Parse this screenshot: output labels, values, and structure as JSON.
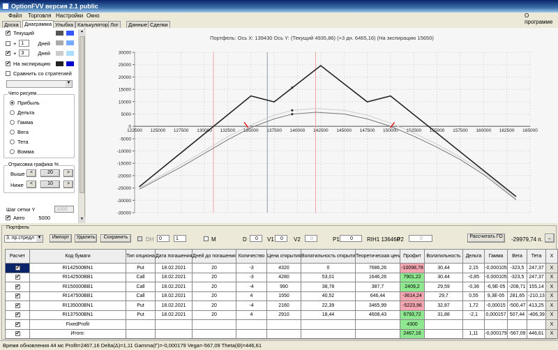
{
  "window": {
    "title": "OptionFVV версия 2.1 public"
  },
  "menu": [
    "Файл",
    "Торговля",
    "Настройки",
    "Окно"
  ],
  "menu_right": "О программе",
  "tabs": [
    "Доска",
    "Диаграмма",
    "Улыбка",
    "Калькулятор",
    "Лог",
    "Данные",
    "Сделки"
  ],
  "active_tab": "Диаграмма",
  "left": {
    "current": {
      "label": "Текущий",
      "checked": true,
      "colors": [
        "#555555",
        "#3355ff"
      ]
    },
    "plus1": {
      "plus": "+",
      "days": "1",
      "unit": "Дней",
      "checked": false,
      "colors": [
        "#aaaaaa",
        "#77aaff"
      ]
    },
    "plus2": {
      "plus": "+",
      "days": "3",
      "unit": "Дней",
      "checked": true,
      "colors": [
        "#cccccc",
        "#aaddff"
      ]
    },
    "expiry": {
      "label": "На экспирацию",
      "checked": true,
      "colors": [
        "#222222",
        "#0000cc"
      ]
    },
    "compare": {
      "label": "Сравнить со стратегией",
      "checked": false
    },
    "draw_group": {
      "title": "Чего рисуем",
      "options": [
        "Прибыль",
        "Дельта",
        "Гамма",
        "Вега",
        "Тета",
        "Вомма"
      ],
      "selected": "Прибыль"
    },
    "range_group": {
      "title": "Отрисовка графика %",
      "above_label": "Выше",
      "above": "20",
      "below_label": "Ниже",
      "below": "10",
      "dec": "<",
      "inc": ">"
    },
    "grid_step_label": "Шаг сетки Y",
    "grid_step": "1000",
    "auto_label": "Авто",
    "auto_checked": true,
    "auto_value": "5000"
  },
  "chart_header": "Портфель: Ось X: 139430 Ось Y:  (Текущий 4935,86)  (+3 дн. 6465,16)  (На экспирацию 15650)",
  "chart_data": {
    "type": "line",
    "xlim": [
      122500,
      165000
    ],
    "ylim": [
      -35000,
      30000
    ],
    "grid": true,
    "xticks": [
      122500,
      125000,
      127500,
      130000,
      132500,
      135000,
      137500,
      140000,
      142500,
      145000,
      147500,
      150000,
      152500,
      155000,
      157500,
      160000,
      162500,
      165000
    ],
    "yticks": [
      30000,
      25000,
      20000,
      15000,
      10000,
      5000,
      0,
      -5000,
      -10000,
      -15000,
      -20000,
      -25000,
      -30000,
      -35000
    ],
    "series": [
      {
        "color": "#222222",
        "x": [
          123000,
          135000,
          137500,
          142500,
          147500,
          150000,
          163500
        ],
        "y": [
          -24500,
          12300,
          9900,
          24600,
          9900,
          12300,
          -28500
        ]
      },
      {
        "color": "#cccccc",
        "x": [
          123000,
          127500,
          130000,
          132500,
          135000,
          137500,
          139430,
          142000,
          145000,
          147500,
          150000,
          152500,
          155000,
          157500,
          160000,
          163500
        ],
        "y": [
          -25000,
          -15500,
          -10000,
          -4200,
          500,
          4500,
          6465,
          7200,
          6500,
          4500,
          1300,
          -2700,
          -7300,
          -12500,
          -18500,
          -29500
        ]
      },
      {
        "color": "#777777",
        "x": [
          123000,
          127500,
          130000,
          132500,
          135000,
          137500,
          139430,
          142000,
          145000,
          147500,
          150000,
          152500,
          155000,
          157500,
          160000,
          163500
        ],
        "y": [
          -25500,
          -16500,
          -11000,
          -5500,
          -500,
          3000,
          4936,
          5700,
          5000,
          3000,
          0,
          -4000,
          -8500,
          -13500,
          -19500,
          -29800
        ]
      }
    ],
    "markers": [
      {
        "x": 139430,
        "y": 15650
      },
      {
        "x": 139430,
        "y": 4936
      },
      {
        "x": 139430,
        "y": 6465
      }
    ],
    "vlines": [
      {
        "x": 130970,
        "color": "#f4a0a0"
      },
      {
        "x": 136760,
        "color": "#8899aa"
      },
      {
        "x": 141950,
        "color": "#f4a0a0"
      }
    ],
    "red_ticks": [
      {
        "x": 134500,
        "y": 500
      },
      {
        "x": 150200,
        "y": 500
      }
    ]
  },
  "portfolio": {
    "title": "Портфель",
    "strategy": "3. пр.стредл",
    "import": "Импорт",
    "delete": "Удалить",
    "save": "Сохранить",
    "dh_label": "DH",
    "dh1": "0",
    "dh2": "1",
    "m_label": "M",
    "d_label": "D",
    "d": "0",
    "v1_label": "V1",
    "v1": "0",
    "v2_label": "V2",
    "v2": "0",
    "p1_label": "P1",
    "p1": "0",
    "ri": "RIH1 136460",
    "p2_label": "P2",
    "p2": "0",
    "calc_go": "Рассчитать ГО",
    "go_value": "-29979,74 п.",
    "minimize": "_",
    "columns": [
      "Расчет",
      "Код бумаги",
      "Тип опциона",
      "Дата погашения",
      "Дней до погашения",
      "Количество",
      "Цена открытия",
      "Волатильность открытия",
      "Теоретическая цена",
      "Профит",
      "Волатильность",
      "Дельта",
      "Гамма",
      "Вега",
      "Тета",
      "X"
    ],
    "rows": [
      [
        "RI142500BN1",
        "Put",
        "18.02.2021",
        "20",
        "-3",
        "4320",
        "0",
        "7686,26",
        "-10098,78",
        "30,44",
        "2,15",
        "-0,000105",
        "-323,5",
        "247,37"
      ],
      [
        "RI142500BB1",
        "Call",
        "18.02.2021",
        "20",
        "-3",
        "4280",
        "53,01",
        "1646,26",
        "7901,22",
        "30,44",
        "-0,85",
        "-0,000105",
        "-323,5",
        "247,37"
      ],
      [
        "RI150000BB1",
        "Call",
        "18.02.2021",
        "20",
        "-4",
        "990",
        "38,78",
        "387,7",
        "2409,2",
        "29,59",
        "-0,36",
        "-6,9E-05",
        "-208,71",
        "155,14"
      ],
      [
        "RI147500BB1",
        "Call",
        "18.02.2021",
        "20",
        "4",
        "1550",
        "40,52",
        "646,44",
        "-3614,24",
        "29,7",
        "0,55",
        "9,3E-05",
        "281,65",
        "-210,13"
      ],
      [
        "RI135000BN1",
        "Put",
        "18.02.2021",
        "20",
        "-4",
        "2160",
        "22,39",
        "3465,99",
        "-5223,96",
        "32,87",
        "1,72",
        "-0,00015",
        "-500,47",
        "413,25"
      ],
      [
        "RI137500BN1",
        "Put",
        "18.02.2021",
        "20",
        "4",
        "2910",
        "18,44",
        "4608,43",
        "6793,72",
        "31,88",
        "-2,1",
        "0,000157",
        "507,44",
        "-406,39"
      ],
      [
        "FixedProfit",
        "",
        "",
        "",
        "",
        "",
        "",
        "",
        "4300",
        "",
        "",
        "",
        "",
        ""
      ],
      [
        "Итого:",
        "",
        "",
        "",
        "",
        "",
        "",
        "",
        "2467,16",
        "",
        "1,11",
        "-0,000179",
        "-567,09",
        "446,61"
      ]
    ],
    "delete_glyph": "X",
    "check_glyph": "✔"
  },
  "status": "Время обновления 44 мс  Profit=2467,16 Delta(Δ)=1,11 Gamma(Γ)=-0,000179 Vega=-567,09 Theta(Θ)=446,61"
}
